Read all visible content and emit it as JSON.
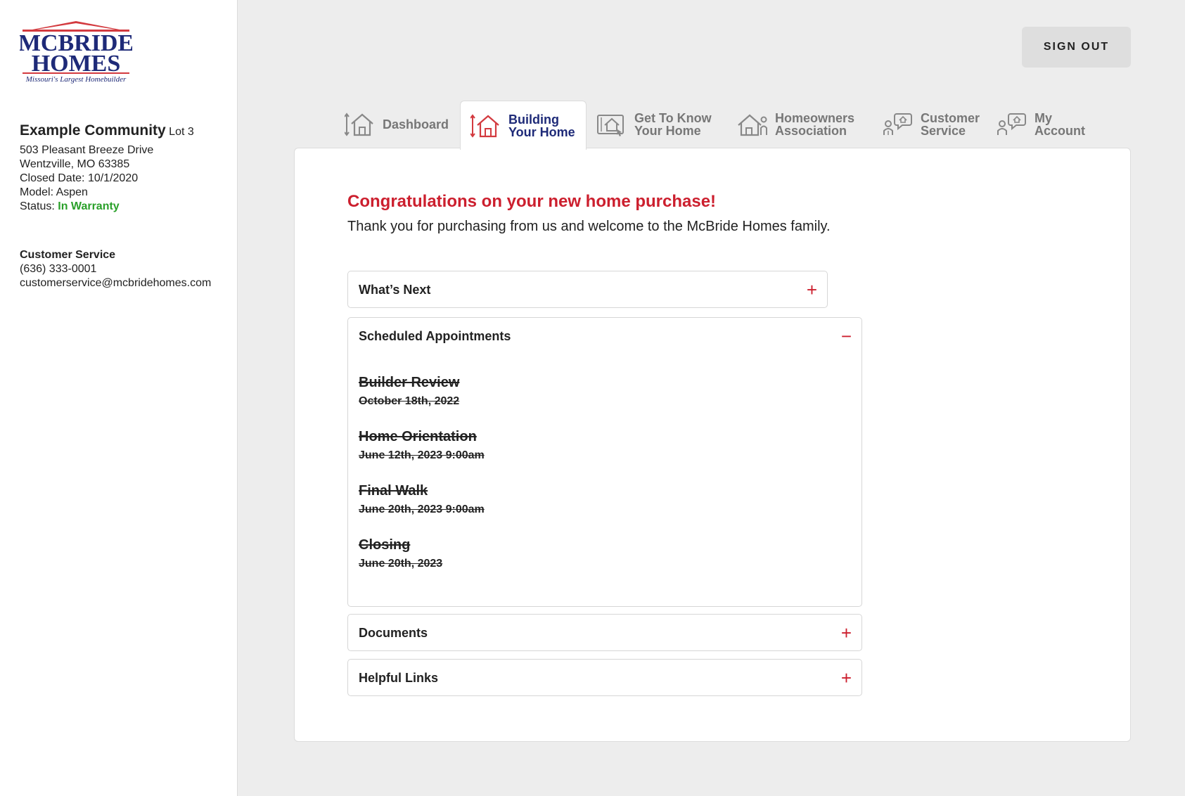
{
  "brand": {
    "logo_line1": "MCBRIDE",
    "logo_line2": "HOMES",
    "tagline": "Missouri's Largest Homebuilder",
    "red": "#d33a3f",
    "navy": "#1e2a78"
  },
  "community": {
    "name": "Example Community",
    "lot": "Lot 3",
    "address": "503 Pleasant Breeze Drive",
    "city": "Wentzville, MO 63385",
    "closed": "Closed Date: 10/1/2020",
    "model": "Model: Aspen",
    "status_label": "Status:",
    "status_value": "In Warranty"
  },
  "contact": {
    "heading": "Customer Service",
    "phone": "(636) 333-0001",
    "email": "customerservice@mcbridehomes.com"
  },
  "header": {
    "signout_label": "SIGN OUT"
  },
  "tabs": [
    {
      "line1": "Dashboard",
      "line2": "",
      "icon": "house-measure-icon"
    },
    {
      "line1": "Building",
      "line2": "Your Home",
      "icon": "house-measure-icon",
      "active": true
    },
    {
      "line1": "Get To Know",
      "line2": "Your Home",
      "icon": "tablet-house-icon"
    },
    {
      "line1": "Homeowners",
      "line2": "Association",
      "icon": "house-person-icon"
    },
    {
      "line1": "Customer",
      "line2": "Service",
      "icon": "person-chat-icon"
    },
    {
      "line1": "My",
      "line2": "Account",
      "icon": "person-house-chat-icon"
    }
  ],
  "main": {
    "headline": "Congratulations on your new home purchase!",
    "subline": "Thank you for purchasing from us and welcome to the McBride Homes family.",
    "sections": {
      "whats_next": {
        "title": "What’s Next",
        "toggle": "+"
      },
      "scheduled": {
        "title": "Scheduled Appointments",
        "toggle": "−"
      },
      "documents": {
        "title": "Documents",
        "toggle": "+"
      },
      "helpful": {
        "title": "Helpful Links",
        "toggle": "+"
      }
    },
    "appointments": [
      {
        "title": "Builder Review",
        "date": "October 18th, 2022"
      },
      {
        "title": "Home Orientation",
        "date": "June 12th, 2023 9:00am"
      },
      {
        "title": "Final Walk",
        "date": "June 20th, 2023 9:00am"
      },
      {
        "title": "Closing",
        "date": "June 20th, 2023"
      }
    ],
    "accent": "#cc1f2e"
  }
}
